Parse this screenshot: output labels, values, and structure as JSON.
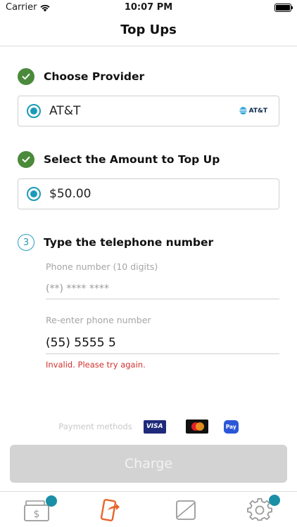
{
  "status_bar": {
    "carrier": "Carrier",
    "time": "10:07 PM"
  },
  "nav": {
    "title": "Top Ups"
  },
  "steps": [
    {
      "label": "Choose Provider",
      "state": "complete",
      "selection": "AT&T",
      "logo_text": "AT&T"
    },
    {
      "label": "Select the Amount to Top Up",
      "state": "complete",
      "selection": "$50.00"
    },
    {
      "number": "3",
      "label": "Type the telephone number",
      "state": "active"
    }
  ],
  "phone": {
    "label": "Phone number (10 digits)",
    "value": "(**) **** ****",
    "reenter_label": "Re-enter phone number",
    "reenter_value": "(55) 5555 5",
    "error": "Invalid. Please try again."
  },
  "payments": {
    "label": "Payment methods",
    "methods": [
      "VISA",
      "Mastercard",
      "Pay"
    ]
  },
  "charge": {
    "label": "Charge",
    "enabled": false
  },
  "tabs": [
    {
      "icon": "wallet-icon",
      "active": false,
      "badge": true
    },
    {
      "icon": "phone-topup-icon",
      "active": true,
      "badge": false
    },
    {
      "icon": "card-icon",
      "active": false,
      "badge": false
    },
    {
      "icon": "gear-icon",
      "active": false,
      "badge": true
    }
  ],
  "colors": {
    "check_green": "#4a8a3a",
    "accent_teal": "#1b9ab8",
    "active_tab": "#e8642a",
    "error_red": "#d0312d",
    "badge": "#1b8fa6"
  }
}
